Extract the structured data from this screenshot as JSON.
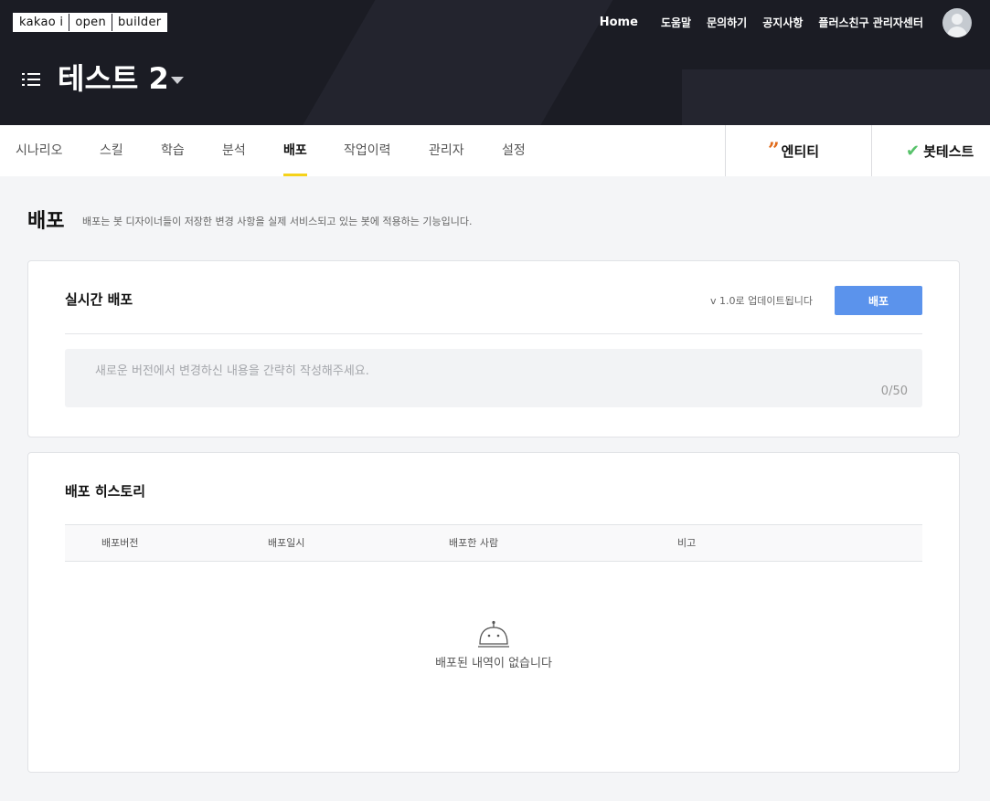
{
  "logo": {
    "parts": [
      "kakao i",
      "open",
      "builder"
    ]
  },
  "topnav": {
    "items": [
      "Home",
      "도움말",
      "문의하기",
      "공지사항",
      "플러스친구 관리자센터"
    ]
  },
  "header": {
    "bot_name": "테스트 2"
  },
  "tabs": [
    "시나리오",
    "스킬",
    "학습",
    "분석",
    "배포",
    "작업이력",
    "관리자",
    "설정"
  ],
  "active_tab": "배포",
  "side_buttons": {
    "entity": "엔티티",
    "bottest": "봇테스트"
  },
  "page": {
    "title": "배포",
    "description": "배포는 봇 디자이너들이 저장한 변경 사항을 실제 서비스되고 있는 봇에 적용하는 기능입니다."
  },
  "realtime": {
    "title": "실시간 배포",
    "version_note": "v 1.0로 업데이트됩니다",
    "deploy_label": "배포",
    "memo_placeholder": "새로운 버전에서 변경하신 내용을 간략히 작성해주세요.",
    "memo_value": "",
    "counter": "0/50"
  },
  "history": {
    "title": "배포 히스토리",
    "columns": [
      "배포버전",
      "배포일시",
      "배포한 사람",
      "비고"
    ],
    "empty_text": "배포된 내역이 없습니다"
  },
  "icons": {
    "menu": "list-icon",
    "caret": "caret-down-icon",
    "entity": "quote-icon",
    "bottest": "check-icon",
    "avatar": "user-avatar-icon",
    "empty": "robot-icon"
  },
  "colors": {
    "header_bg": "#1b1c24",
    "accent_tab": "#f5d21a",
    "deploy_button": "#5b93ec",
    "entity_icon": "#e06a1a",
    "check_icon": "#57c26a"
  }
}
